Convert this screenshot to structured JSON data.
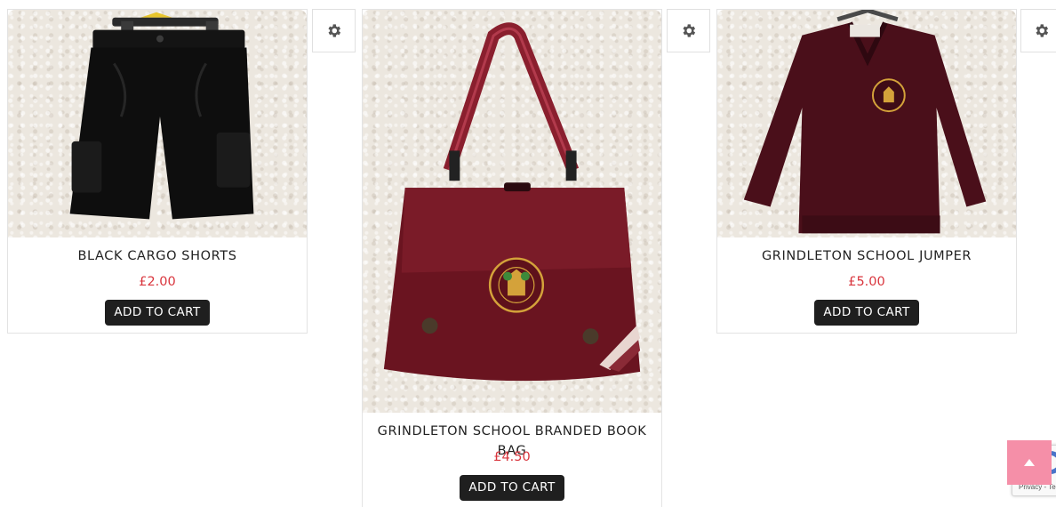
{
  "products": [
    {
      "title": "BLACK CARGO SHORTS",
      "price": "£2.00",
      "cta": "ADD TO CART"
    },
    {
      "title": "GRINDLETON SCHOOL BRANDED BOOK BAG",
      "price": "£4.50",
      "cta": "ADD TO CART"
    },
    {
      "title": "GRINDLETON SCHOOL JUMPER",
      "price": "£5.00",
      "cta": "ADD TO CART"
    }
  ],
  "icons": {
    "settings": "gear-icon",
    "back_to_top": "chevron-up-icon"
  },
  "recaptcha": {
    "text": "Privacy - Te"
  },
  "colors": {
    "price": "#d9363e",
    "button": "#1f1f1f",
    "back_to_top": "#f58fa8",
    "maroon": "#6b1a24"
  }
}
